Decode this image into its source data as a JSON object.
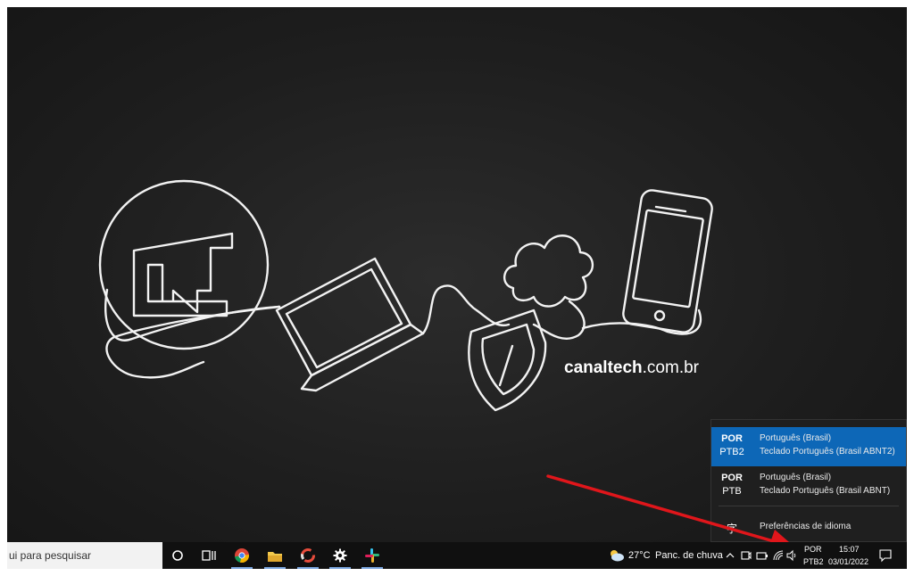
{
  "wallpaper": {
    "brand_bold": "canaltech",
    "brand_rest": ".com.br"
  },
  "taskbar": {
    "search_placeholder": "ui para pesquisar",
    "apps": [
      {
        "name": "cortana",
        "icon": "circle-icon"
      },
      {
        "name": "task-view",
        "icon": "task-view-icon"
      },
      {
        "name": "chrome",
        "icon": "chrome-icon"
      },
      {
        "name": "file-explorer",
        "icon": "folder-icon"
      },
      {
        "name": "app",
        "icon": "ring-app-icon"
      },
      {
        "name": "settings",
        "icon": "gear-icon"
      },
      {
        "name": "slack",
        "icon": "slack-icon"
      }
    ],
    "weather": {
      "temp": "27°C",
      "desc": "Panc. de chuva",
      "icon": "cloud-rain-icon"
    },
    "language_indicator": {
      "line1": "POR",
      "line2": "PTB2"
    },
    "clock": {
      "time": "15:07",
      "date": "03/01/2022"
    }
  },
  "lang_flyout": {
    "items": [
      {
        "code": "POR",
        "sub": "PTB2",
        "language": "Português (Brasil)",
        "keyboard": "Teclado Português (Brasil ABNT2)",
        "selected": true
      },
      {
        "code": "POR",
        "sub": "PTB",
        "language": "Português (Brasil)",
        "keyboard": "Teclado Português (Brasil ABNT)",
        "selected": false
      }
    ],
    "preferences_label": "Preferências de idioma",
    "preferences_icon_glyph": "字"
  },
  "colors": {
    "accent": "#0d67b7",
    "arrow": "#e0161b",
    "taskbar": "#101010"
  }
}
